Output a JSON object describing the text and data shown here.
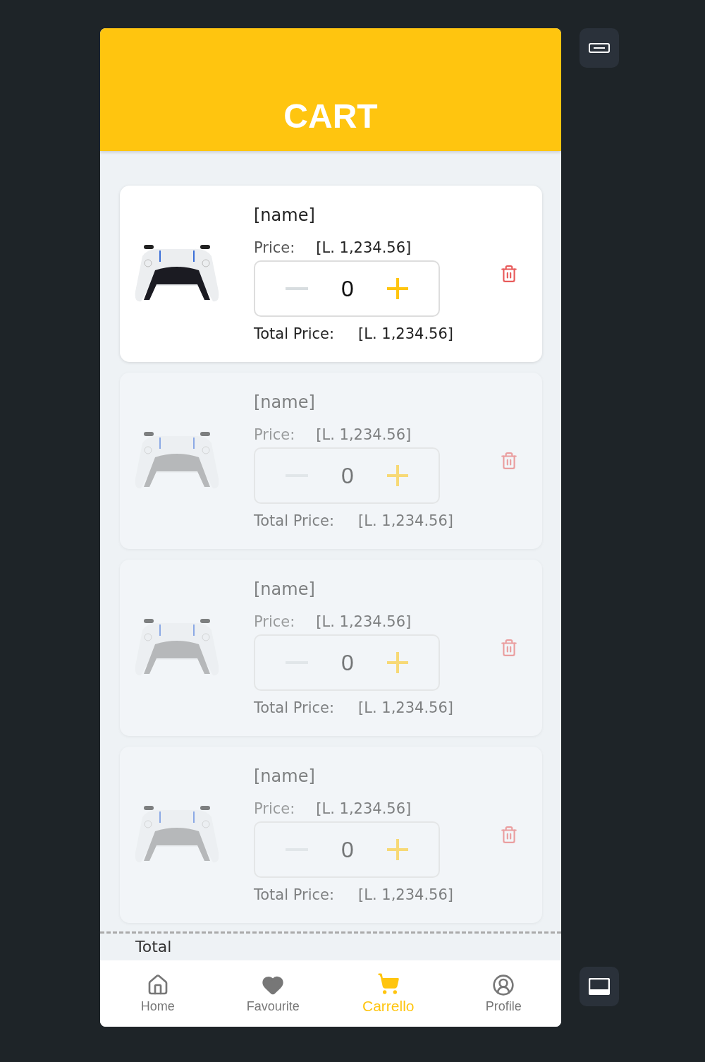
{
  "header": {
    "title": "CART"
  },
  "items": [
    {
      "name": "[name]",
      "price_label": "Price:",
      "price": "[L. 1,234.56]",
      "quantity": "0",
      "total_label": "Total Price:",
      "total": "[L. 1,234.56]",
      "selected": true
    },
    {
      "name": "[name]",
      "price_label": "Price:",
      "price": "[L. 1,234.56]",
      "quantity": "0",
      "total_label": "Total Price:",
      "total": "[L. 1,234.56]",
      "selected": false
    },
    {
      "name": "[name]",
      "price_label": "Price:",
      "price": "[L. 1,234.56]",
      "quantity": "0",
      "total_label": "Total Price:",
      "total": "[L. 1,234.56]",
      "selected": false
    },
    {
      "name": "[name]",
      "price_label": "Price:",
      "price": "[L. 1,234.56]",
      "quantity": "0",
      "total_label": "Total Price:",
      "total": "[L. 1,234.56]",
      "selected": false
    }
  ],
  "summary": {
    "label": "Total"
  },
  "nav": [
    {
      "label": "Home",
      "selected": false
    },
    {
      "label": "Favourite",
      "selected": false
    },
    {
      "label": "Carrello",
      "selected": true
    },
    {
      "label": "Profile",
      "selected": false
    }
  ]
}
